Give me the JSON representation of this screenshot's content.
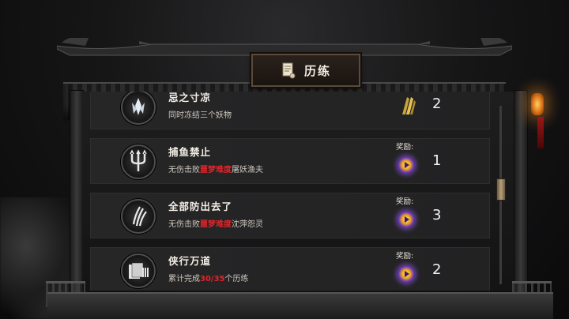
{
  "window": {
    "title": "历练"
  },
  "achievements": [
    {
      "name": "忌之寸凉",
      "desc_parts": [
        "同时冻结三个妖物"
      ],
      "reward_label": "",
      "reward_icon": "feather-icon",
      "count": "2"
    },
    {
      "name": "捕鱼禁止",
      "desc_parts": [
        "无伤击败",
        "噩梦难度",
        "屠妖渔夫"
      ],
      "reward_label": "奖励:",
      "reward_icon": "purple-orb-icon",
      "count": "1"
    },
    {
      "name": "全部防出去了",
      "desc_parts": [
        "无伤击败",
        "噩梦难度",
        "沈萍怨灵"
      ],
      "reward_label": "奖励:",
      "reward_icon": "purple-orb-icon",
      "count": "3"
    },
    {
      "name": "侠行万道",
      "desc_parts": [
        "累计完成",
        "30/35",
        "个历练"
      ],
      "reward_label": "奖励:",
      "reward_icon": "purple-orb-icon",
      "count": "2"
    }
  ],
  "colors": {
    "highlight": "#e0242a",
    "text": "#f4efe6",
    "panel": "#1e1e1f",
    "accent": "#b79f78"
  }
}
